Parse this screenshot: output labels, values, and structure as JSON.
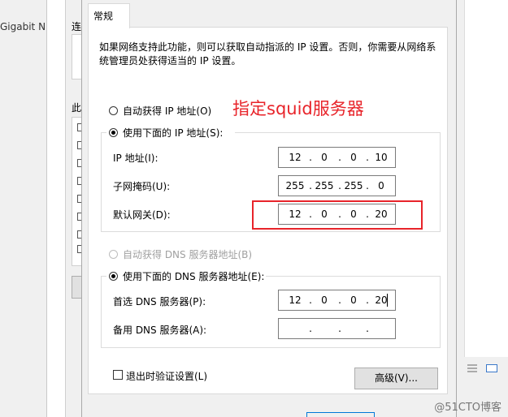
{
  "background": {
    "left_window_text": "Gigabit N",
    "mid_window_label_top": "连",
    "mid_window_label_list": "此"
  },
  "tab": {
    "label": "常规"
  },
  "description": "如果网络支持此功能，则可以获取自动指派的 IP 设置。否则，你需要从网络系统管理员处获得适当的 IP 设置。",
  "auto_ip_label": "自动获得 IP 地址(O)",
  "manual_ip_label": "使用下面的 IP 地址(S):",
  "ip_fields": {
    "ip_label": "IP 地址(I):",
    "ip": [
      "12",
      "0",
      "0",
      "10"
    ],
    "mask_label": "子网掩码(U):",
    "mask": [
      "255",
      "255",
      "255",
      "0"
    ],
    "gateway_label": "默认网关(D):",
    "gateway": [
      "12",
      "0",
      "0",
      "20"
    ]
  },
  "dns_auto_label": "自动获得 DNS 服务器地址(B)",
  "dns_manual_label": "使用下面的 DNS 服务器地址(E):",
  "dns_fields": {
    "preferred_label": "首选 DNS 服务器(P):",
    "preferred": [
      "12",
      "0",
      "0",
      "20"
    ],
    "alternate_label": "备用 DNS 服务器(A):",
    "alternate": [
      "",
      "",
      "",
      ""
    ]
  },
  "validate_label": "退出时验证设置(L)",
  "advanced_button": "高级(V)...",
  "annotation": "指定squid服务器",
  "watermark": "@51CTO博客",
  "colors": {
    "annotation": "#e8242a",
    "focus": "#0078d7"
  }
}
